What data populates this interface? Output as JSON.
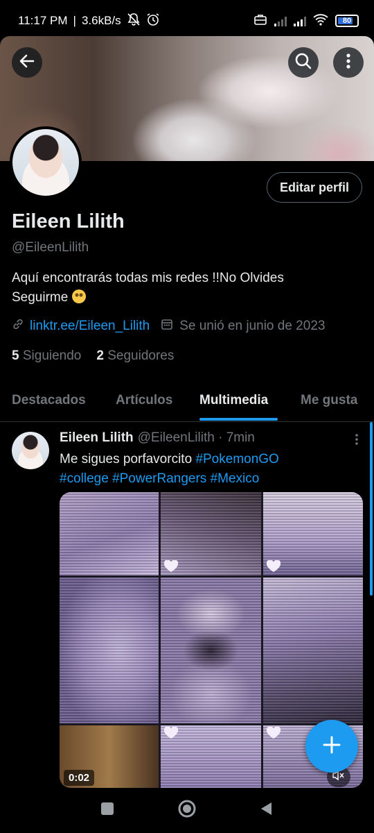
{
  "status_bar": {
    "time": "11:17 PM",
    "separator": "|",
    "speed": "3.6kB/s",
    "battery": "80"
  },
  "banner": {
    "back_icon": "arrow-left-icon",
    "search_icon": "search-icon",
    "more_icon": "more-vertical-icon"
  },
  "profile": {
    "edit_button": "Editar perfil",
    "name": "Eileen Lilith",
    "handle": "@EileenLilith",
    "bio_line1": "Aquí encontrarás todas mis redes !!No Olvides",
    "bio_line2": "Seguirme",
    "link": "linktr.ee/Eileen_Lilith",
    "joined": "Se unió en junio de 2023",
    "following_count": "5",
    "following_label": "Siguiendo",
    "followers_count": "2",
    "followers_label": "Seguidores"
  },
  "tabs": [
    {
      "label": "Destacados"
    },
    {
      "label": "Artículos"
    },
    {
      "label": "Multimedia"
    },
    {
      "label": "Me gusta"
    }
  ],
  "tweet": {
    "name": "Eileen Lilith",
    "handle_time": "@EileenLilith · 7min",
    "text_plain": "Me sigues porfavorcito",
    "tags": [
      "#PokemonGO",
      "#college",
      "#PowerRangers",
      "#Mexico"
    ],
    "video_time": "0:02"
  },
  "colors": {
    "accent": "#1d9bf0",
    "text": "#e7e9ea",
    "muted": "#71767b",
    "background": "#000000"
  }
}
